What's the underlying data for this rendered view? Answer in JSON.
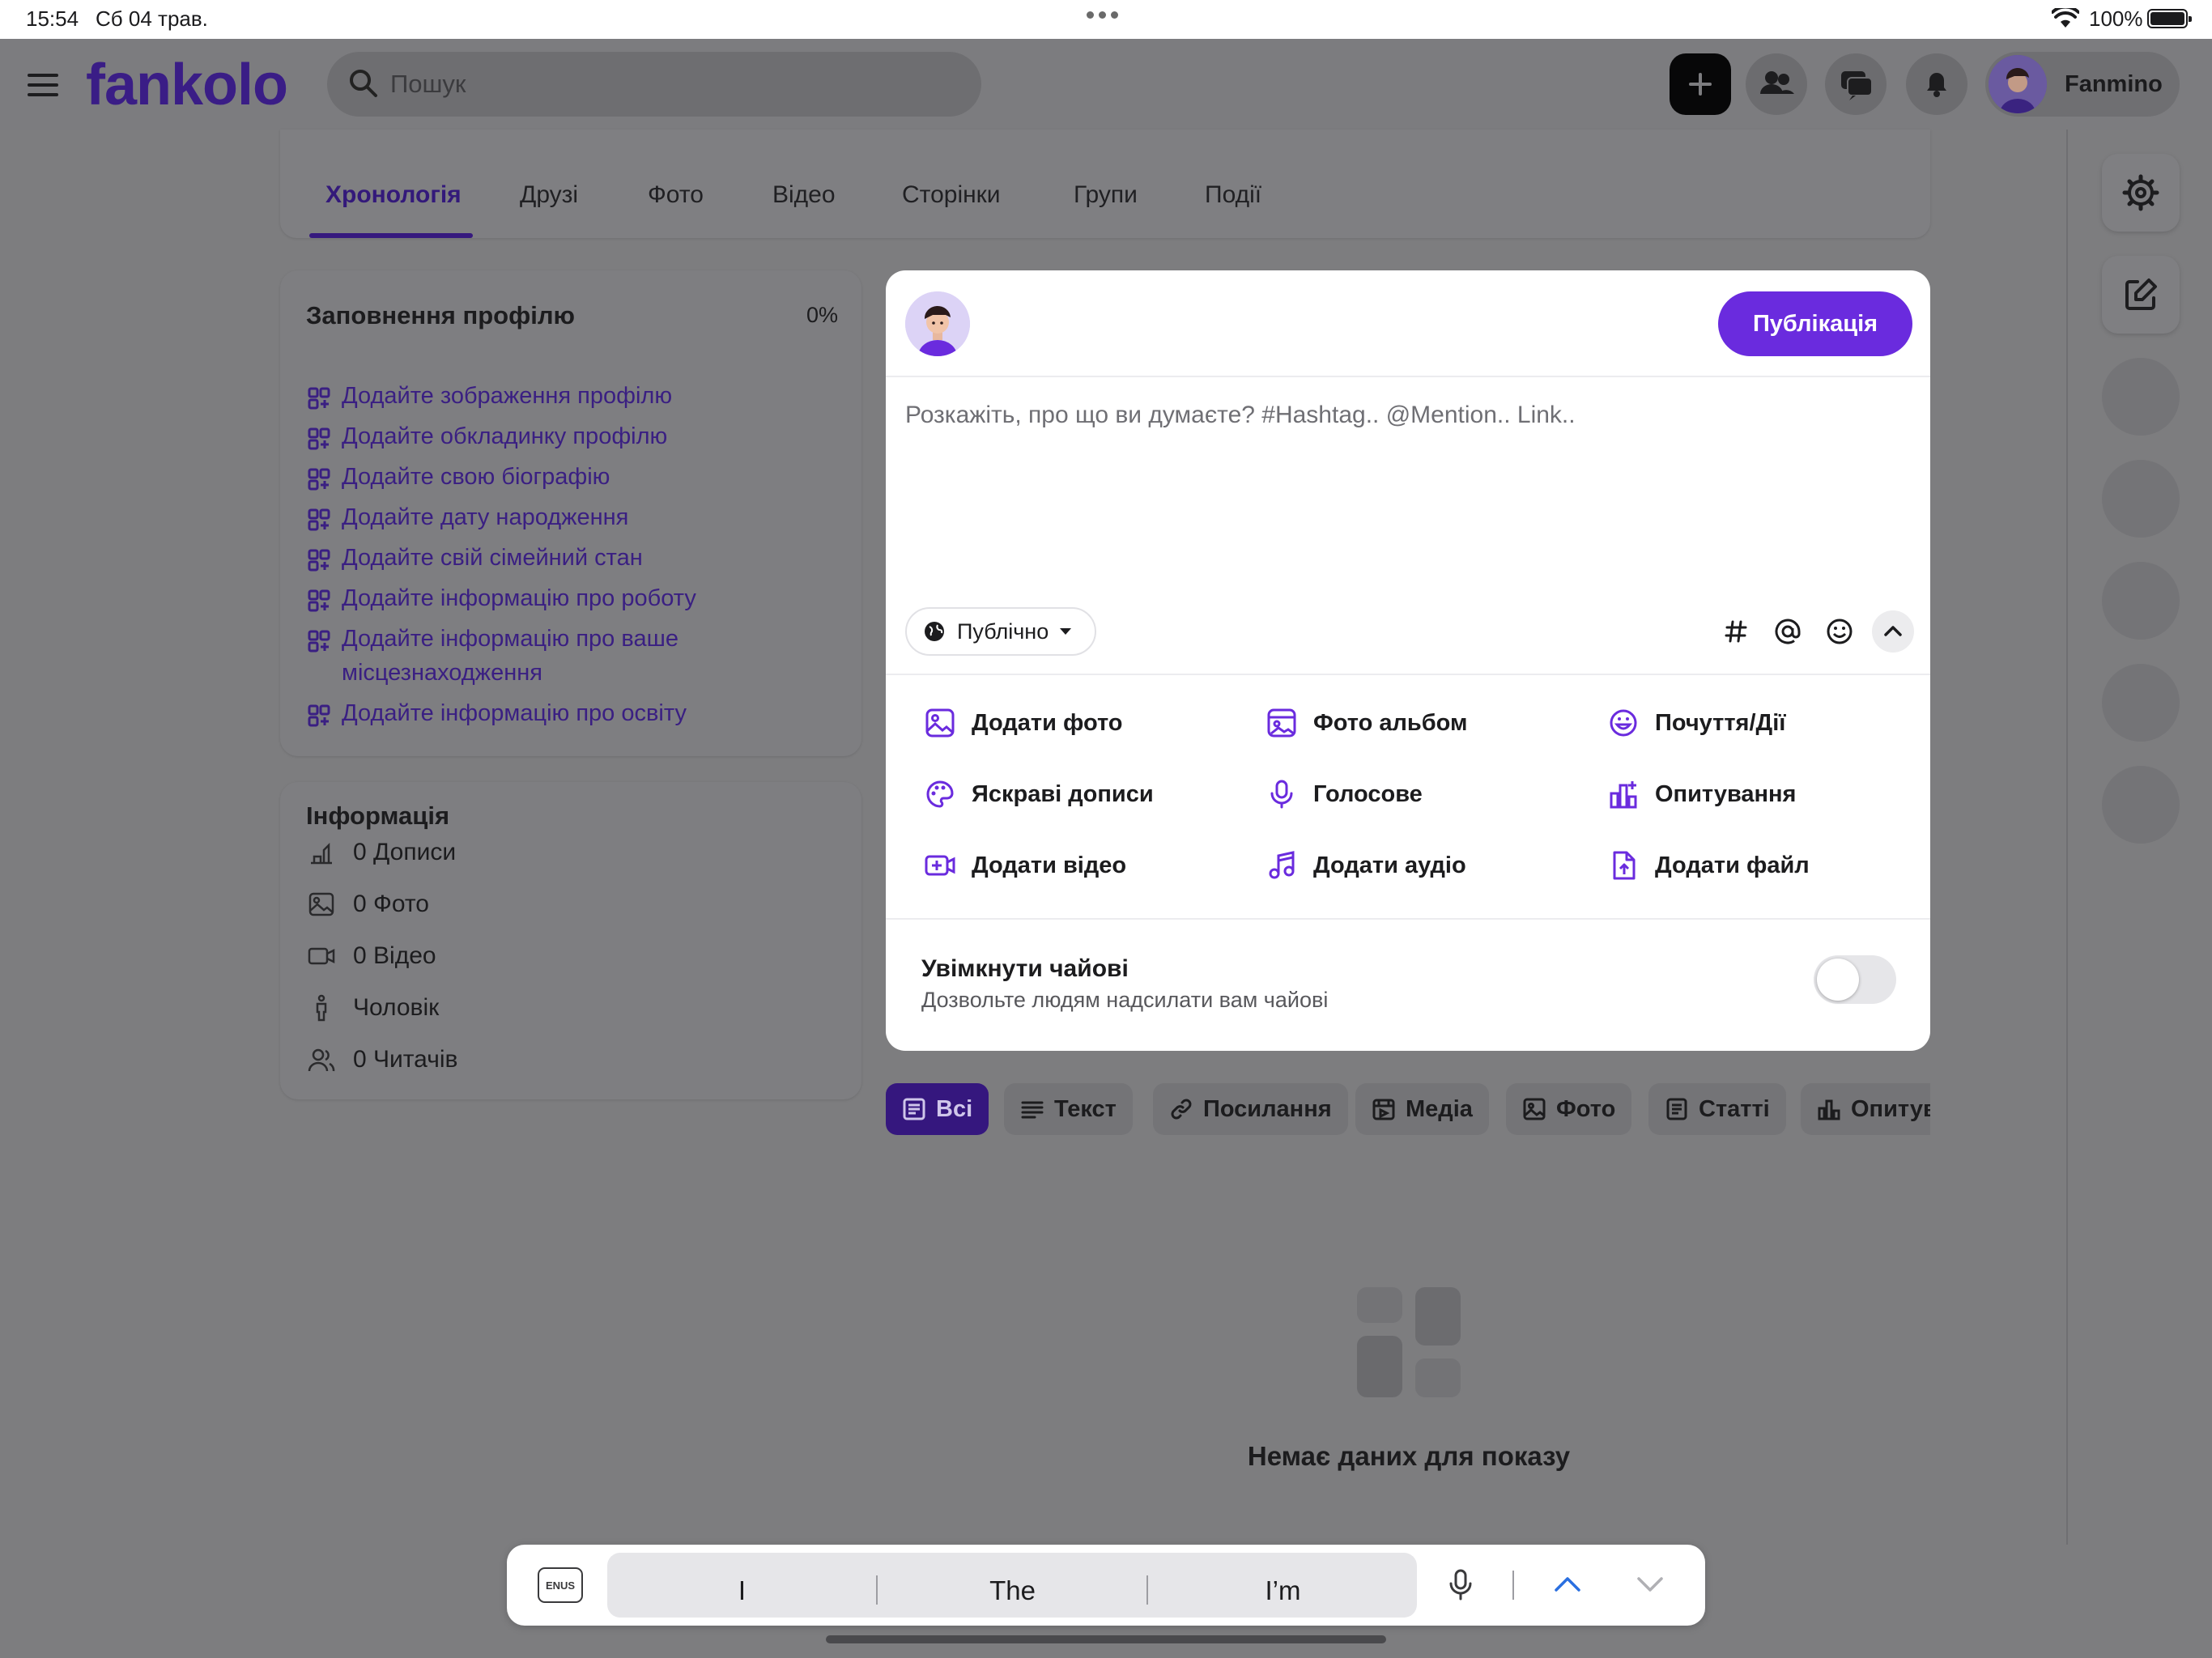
{
  "status_bar": {
    "time": "15:54",
    "date": "Сб 04 трав.",
    "battery": "100%"
  },
  "header": {
    "logo": "fankolo",
    "search_placeholder": "Пошук",
    "user_name": "Fanmino"
  },
  "profile_tabs": [
    "Хронологія",
    "Друзі",
    "Фото",
    "Відео",
    "Сторінки",
    "Групи",
    "Події"
  ],
  "profile_completion": {
    "title": "Заповнення профілю",
    "percent": "0%",
    "items": [
      "Додайте зображення профілю",
      "Додайте обкладинку профілю",
      "Додайте свою біографію",
      "Додайте дату народження",
      "Додайте свій сімейний стан",
      "Додайте інформацію про роботу",
      "Додайте інформацію про ваше місцезнаходження",
      "Додайте інформацію про освіту"
    ]
  },
  "info": {
    "title": "Інформація",
    "items": [
      "0 Дописи",
      "0 Фото",
      "0 Відео",
      "Чоловік",
      "0 Читачів"
    ]
  },
  "composer": {
    "publish_label": "Публікація",
    "placeholder": "Розкажіть, про що ви думаєте? #Hashtag.. @Mention.. Link..",
    "privacy": "Публічно",
    "options": [
      "Додати фото",
      "Фото альбом",
      "Почуття/Дії",
      "Яскраві дописи",
      "Голосове",
      "Опитування",
      "Додати відео",
      "Додати аудіо",
      "Додати файл"
    ],
    "tips_title": "Увімкнути чайові",
    "tips_subtitle": "Дозвольте людям надсилати вам чайові"
  },
  "filters": [
    "Всі",
    "Текст",
    "Посилання",
    "Медіа",
    "Фото",
    "Статті",
    "Опитування"
  ],
  "empty_state": "Немає даних для показу",
  "keyboard": {
    "lang": "ENUS",
    "suggestions": [
      "I",
      "The",
      "I’m"
    ]
  },
  "colors": {
    "accent": "#6a2bde",
    "link_dark": "#3a1f82",
    "overlay_bg": "#7d7d7f"
  }
}
